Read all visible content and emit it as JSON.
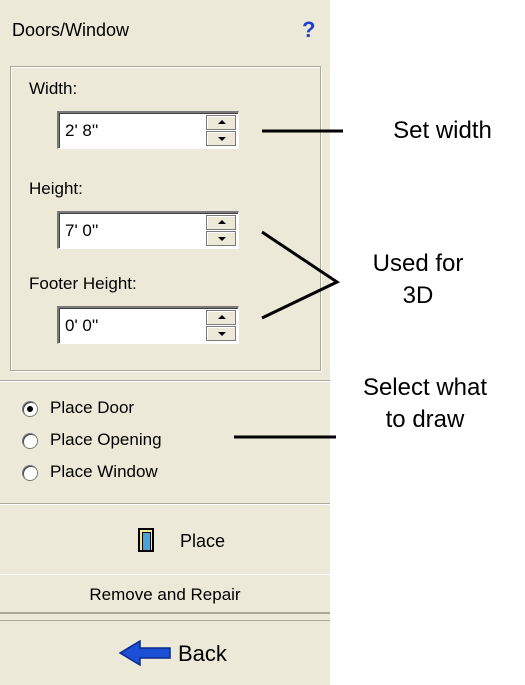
{
  "panel": {
    "title": "Doors/Window",
    "help_glyph": "?",
    "fields": [
      {
        "label": "Width:",
        "value": "2' 8''"
      },
      {
        "label": "Height:",
        "value": "7' 0''"
      },
      {
        "label": "Footer Height:",
        "value": "0' 0''"
      }
    ],
    "options": [
      {
        "label": "Place Door",
        "checked": true
      },
      {
        "label": "Place Opening",
        "checked": false
      },
      {
        "label": "Place Window",
        "checked": false
      }
    ],
    "place_label": "Place",
    "remove_label": "Remove and Repair",
    "back_label": "Back"
  },
  "annotations": {
    "set_width": "Set width",
    "used_for_line1": "Used for",
    "used_for_line2": "3D",
    "select_line1": "Select what",
    "select_line2": "to draw"
  },
  "icons": {
    "help": "question-mark-icon",
    "place": "door-icon",
    "back": "left-arrow-icon"
  },
  "colors": {
    "panel_bg": "#ece9d8",
    "help_blue": "#1f3fd1",
    "arrow_blue": "#1a4fd6"
  }
}
